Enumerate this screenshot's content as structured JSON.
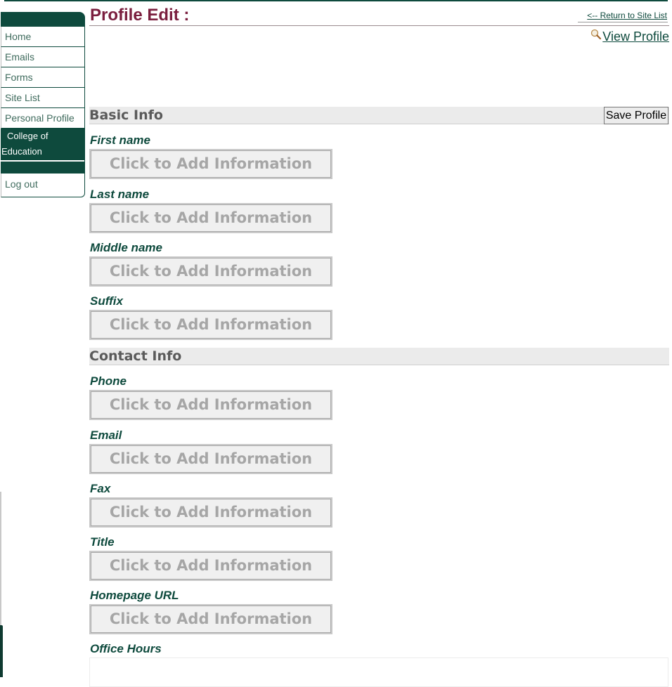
{
  "header": {
    "title": "Profile Edit :",
    "return_link": "<-- Return to Site List",
    "view_profile": "View Profile",
    "view_profile_icon": "magnifier-icon"
  },
  "sidebar": {
    "items": [
      {
        "label": "Home"
      },
      {
        "label": "Emails"
      },
      {
        "label": "Forms"
      },
      {
        "label": "Site List"
      },
      {
        "label": "Personal Profile"
      }
    ],
    "college_line1": "College of",
    "college_line2": "Education",
    "logout": "Log out"
  },
  "sections": {
    "basic": {
      "title": "Basic Info",
      "save_label": "Save Profile",
      "fields": [
        {
          "label": "First name",
          "value": "Click to Add Information"
        },
        {
          "label": "Last name",
          "value": "Click to Add Information"
        },
        {
          "label": "Middle name",
          "value": "Click to Add Information"
        },
        {
          "label": "Suffix",
          "value": "Click to Add Information"
        }
      ]
    },
    "contact": {
      "title": "Contact Info",
      "fields": [
        {
          "label": "Phone",
          "value": "Click to Add Information"
        },
        {
          "label": "Email",
          "value": "Click to Add Information"
        },
        {
          "label": "Fax",
          "value": "Click to Add Information"
        },
        {
          "label": "Title",
          "value": "Click to Add Information"
        },
        {
          "label": "Homepage URL",
          "value": "Click to Add Information"
        }
      ],
      "office_hours_label": "Office Hours",
      "office_hours_value": ""
    }
  },
  "colors": {
    "brand_green": "#0e4a3d",
    "title_maroon": "#7a1e3e",
    "placeholder_gray": "#a6a6a6"
  }
}
